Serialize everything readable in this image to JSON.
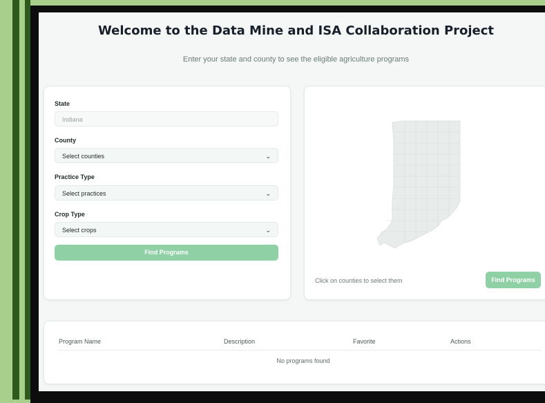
{
  "header": {
    "title": "Welcome to the Data Mine and ISA Collaboration Project",
    "subtitle": "Enter your state and county to see the eligible agriculture programs"
  },
  "form": {
    "state_label": "State",
    "state_placeholder": "Indiana",
    "county_label": "County",
    "county_value": "Select counties",
    "practice_label": "Practice Type",
    "practice_value": "Select practices",
    "crop_label": "Crop Type",
    "crop_value": "Select crops",
    "find_button": "Find Programs"
  },
  "map": {
    "hint": "Click on counties to select them",
    "find_button": "Find Programs"
  },
  "results": {
    "columns": [
      "Program Name",
      "Description",
      "Favorite",
      "Actions"
    ],
    "empty_text": "No programs found"
  },
  "colors": {
    "accent": "#8fd0a5",
    "background": "#a9cf8c",
    "frame": "#0d0d0d"
  }
}
